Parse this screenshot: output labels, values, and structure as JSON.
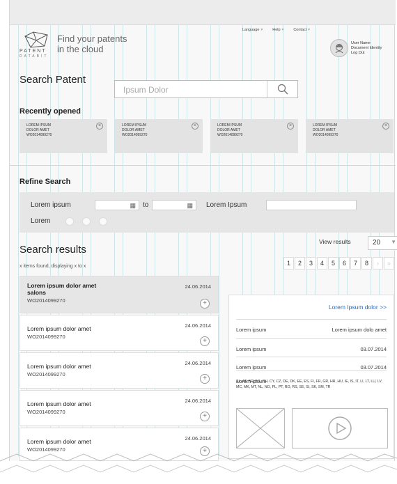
{
  "header": {
    "logo_text": "PATENT",
    "logo_subtext": "DATABIT",
    "tagline": "Find your patents\nin the cloud",
    "nav": [
      "Language",
      "Help",
      "Contact"
    ],
    "user": {
      "name": "User Name",
      "document_identity": "Document Identity",
      "logout": "Log Out"
    }
  },
  "search": {
    "title": "Search Patent",
    "placeholder": "Ipsum Dolor"
  },
  "recent": {
    "title": "Recently opened",
    "cards": [
      {
        "line1": "LOREM IPSUM",
        "line2": "DOLOR AMET",
        "code": "WO2014099270"
      },
      {
        "line1": "LOREM IPSUM",
        "line2": "DOLOR AMET",
        "code": "WO2014099270"
      },
      {
        "line1": "LOREM IPSUM",
        "line2": "DOLOR AMET",
        "code": "WO2014099270"
      },
      {
        "line1": "LOREM IPSUM",
        "line2": "DOLOR AMET",
        "code": "WO2014099270"
      }
    ]
  },
  "refine": {
    "title": "Refine Search",
    "label1": "Lorem ipsum",
    "to": "to",
    "label2": "Lorem Ipsum",
    "label3": "Lorem"
  },
  "results": {
    "title": "Search  results",
    "subtitle": "x items found, displaying x to x",
    "view_label": "View results",
    "view_value": "20",
    "pages": [
      "1",
      "2",
      "3",
      "4",
      "5",
      "6",
      "7",
      "8",
      "›",
      "»"
    ],
    "items": [
      {
        "title": "Lorem ipsum dolor amet salons",
        "code": "WO2014099270",
        "date": "24.06.2014"
      },
      {
        "title": "Lorem ipsum dolor amet",
        "code": "WO2014099270",
        "date": "24.06.2014"
      },
      {
        "title": "Lorem ipsum dolor amet",
        "code": "WO2014099270",
        "date": "24.06.2014"
      },
      {
        "title": "Lorem ipsum dolor amet",
        "code": "WO2014099270",
        "date": "24.06.2014"
      },
      {
        "title": "Lorem ipsum dolor amet",
        "code": "WO2014099270",
        "date": "24.06.2014"
      }
    ]
  },
  "detail": {
    "link": "Lorem Ipsum dolor >>",
    "rows": [
      {
        "label": "Lorem ipsum",
        "value": "Lorem ipsum dolo amet"
      },
      {
        "label": "Lorem ipsum",
        "value": "03.07.2014"
      },
      {
        "label": "Lorem ipsum",
        "value": "03.07.2014"
      }
    ],
    "codes_label": "Lorem ipsum",
    "codes": "AL, AT, BE, BG, CH, CY, CZ, DE, DK, EE, ES, FI, FR, GR, HR, HU, IE, IS, IT, LI, LT, LU, LV, MC, MK, MT, NL, NO, PL, PT, RO, RS, SE, SI, SK, SM, TR"
  },
  "colors": {
    "link": "#2a6ab8",
    "panel": "#e6e6e6",
    "grid_guides": "#78c8d2"
  },
  "icons": [
    "logo-icon",
    "avatar-icon",
    "search-icon",
    "close-icon",
    "calendar-icon",
    "plus-icon",
    "image-placeholder-icon",
    "play-icon",
    "dropdown-arrow-icon"
  ]
}
